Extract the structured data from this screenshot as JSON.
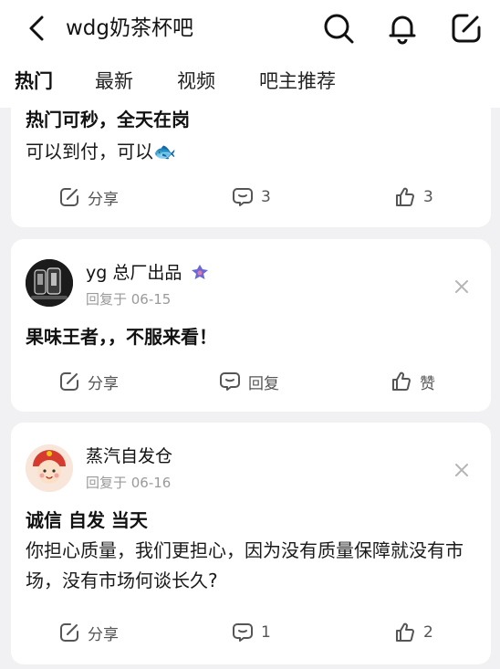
{
  "header": {
    "title": "wdg奶茶杯吧",
    "icons": [
      "back-icon",
      "search-icon",
      "bell-icon",
      "edit-icon"
    ]
  },
  "tabs": [
    {
      "label": "热门",
      "active": true
    },
    {
      "label": "最新",
      "active": false
    },
    {
      "label": "视频",
      "active": false
    },
    {
      "label": "吧主推荐",
      "active": false
    }
  ],
  "posts": [
    {
      "title": "热门可秒，全天在岗",
      "body": "可以到付，可以🐟",
      "actions": {
        "share": "分享",
        "comments": "3",
        "likes": "3"
      }
    },
    {
      "user": "yg 总厂出品",
      "meta": "回复于 06-15",
      "title": "果味王者，，不服来看！",
      "actions": {
        "share": "分享",
        "comments": "回复",
        "likes": "赞"
      }
    },
    {
      "user": "蒸汽自发仓",
      "meta": "回复于 06-16",
      "title": "诚信 自发 当天",
      "body": "你担心质量，我们更担心，因为没有质量保障就没有市场，没有市场何谈长久?",
      "actions": {
        "share": "分享",
        "comments": "1",
        "likes": "2"
      }
    }
  ],
  "colors": {
    "accent": "#3b82f6",
    "background": "#f1f1f3",
    "muted": "#9a9a9a"
  }
}
